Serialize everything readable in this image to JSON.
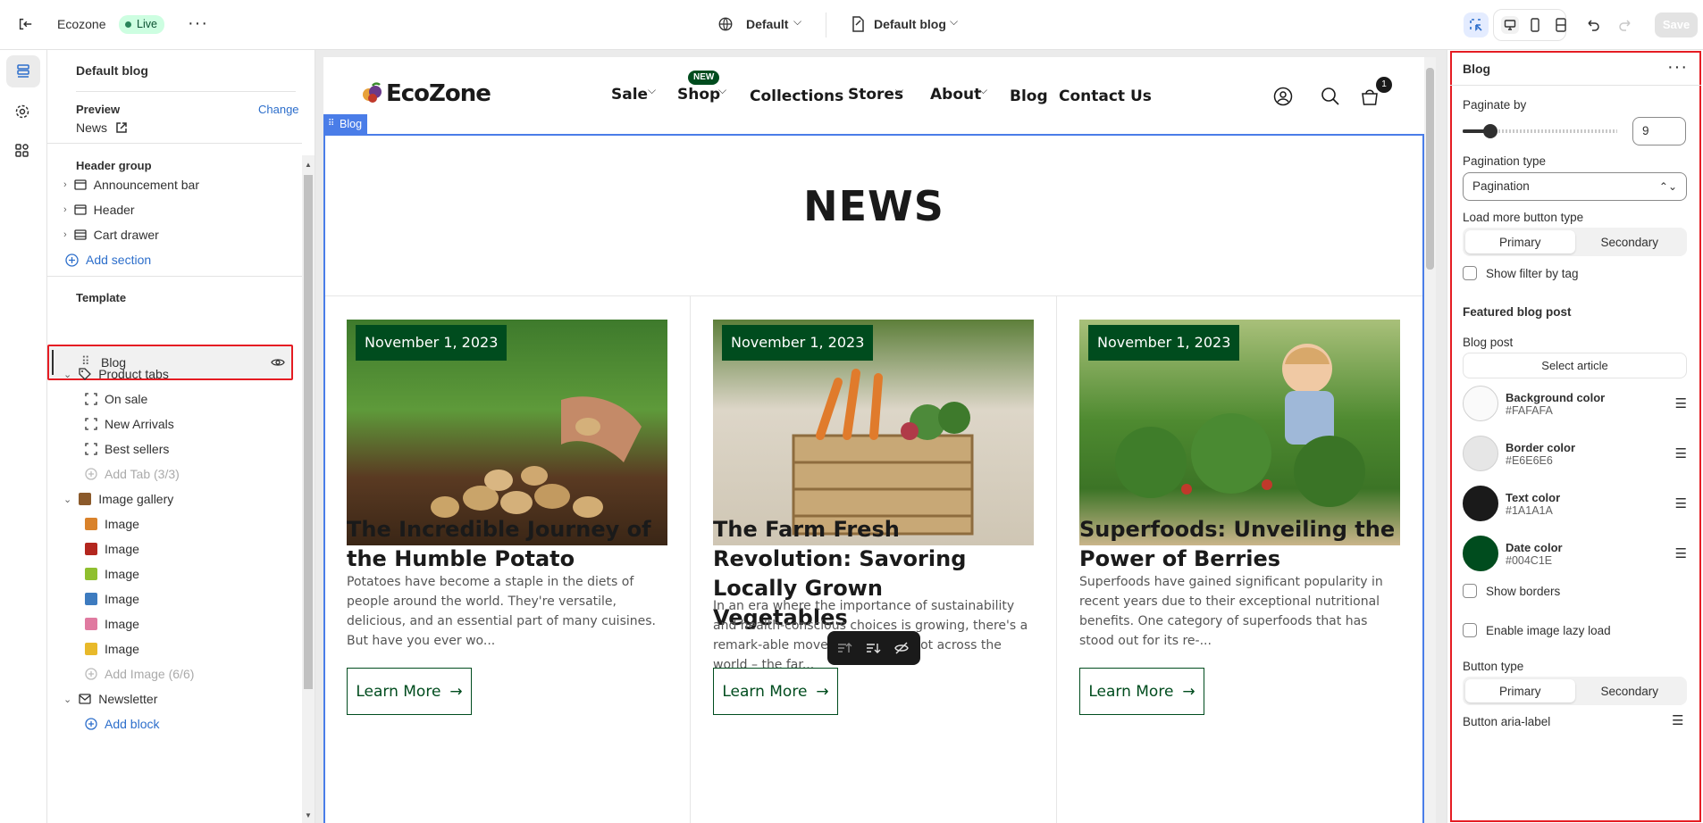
{
  "topbar": {
    "store": "Ecozone",
    "status": "Live",
    "theme": "Default",
    "template": "Default blog",
    "save": "Save"
  },
  "left": {
    "title": "Default blog",
    "preview_label": "Preview",
    "preview_change": "Change",
    "preview_value": "News",
    "header_group": "Header group",
    "header_items": [
      "Announcement bar",
      "Header",
      "Cart drawer"
    ],
    "add_section": "Add section",
    "template_label": "Template",
    "blog": "Blog",
    "product_tabs": "Product tabs",
    "tabs": [
      "On sale",
      "New Arrivals",
      "Best sellers"
    ],
    "add_tab": "Add Tab (3/3)",
    "image_gallery": "Image gallery",
    "images": [
      "Image",
      "Image",
      "Image",
      "Image",
      "Image",
      "Image"
    ],
    "add_image": "Add Image (6/6)",
    "newsletter": "Newsletter",
    "add_block": "Add block"
  },
  "site": {
    "logo": "EcoZone",
    "nav": [
      "Sale",
      "Shop",
      "Collections",
      "Stores",
      "About",
      "Blog",
      "Contact Us"
    ],
    "new_badge": "NEW",
    "cart_count": "1",
    "section_tag": "Blog",
    "heading": "NEWS",
    "posts": [
      {
        "date": "November 1, 2023",
        "title": "The Incredible Journey of the Humble Potato",
        "excerpt": "Potatoes have become a staple in the diets of people around the world. They're versatile, delicious, and an essential part of many cuisines. But have you ever wo...",
        "cta": "Learn More"
      },
      {
        "date": "November 1, 2023",
        "title": "The Farm Fresh Revolution: Savoring Locally Grown Vegetables",
        "excerpt": "In an era where the importance of sustainability and health-conscious choices is growing, there's a remark-able movement taking root across the world – the far...",
        "cta": "Learn More"
      },
      {
        "date": "November 1, 2023",
        "title": "Superfoods: Unveiling the Power of Berries",
        "excerpt": "Superfoods have gained significant popularity in recent years due to their exceptional nutritional benefits. One category of superfoods that has stood out for its re-...",
        "cta": "Learn More"
      }
    ]
  },
  "right": {
    "title": "Blog",
    "paginate_label": "Paginate by",
    "paginate_value": "9",
    "pagination_type_label": "Pagination type",
    "pagination_type_value": "Pagination",
    "load_more_label": "Load more button type",
    "seg_primary": "Primary",
    "seg_secondary": "Secondary",
    "show_filter": "Show filter by tag",
    "featured_heading": "Featured blog post",
    "blog_post_label": "Blog post",
    "select_article": "Select article",
    "colors": [
      {
        "name": "Background color",
        "hex": "#FAFAFA"
      },
      {
        "name": "Border color",
        "hex": "#E6E6E6"
      },
      {
        "name": "Text color",
        "hex": "#1A1A1A"
      },
      {
        "name": "Date color",
        "hex": "#004C1E"
      }
    ],
    "show_borders": "Show borders",
    "lazy_load": "Enable image lazy load",
    "button_type_label": "Button type",
    "aria_label": "Button aria-label"
  },
  "colors": {
    "accent": "#004c1e",
    "selection": "#e51c23",
    "outline": "#4a7de8"
  }
}
